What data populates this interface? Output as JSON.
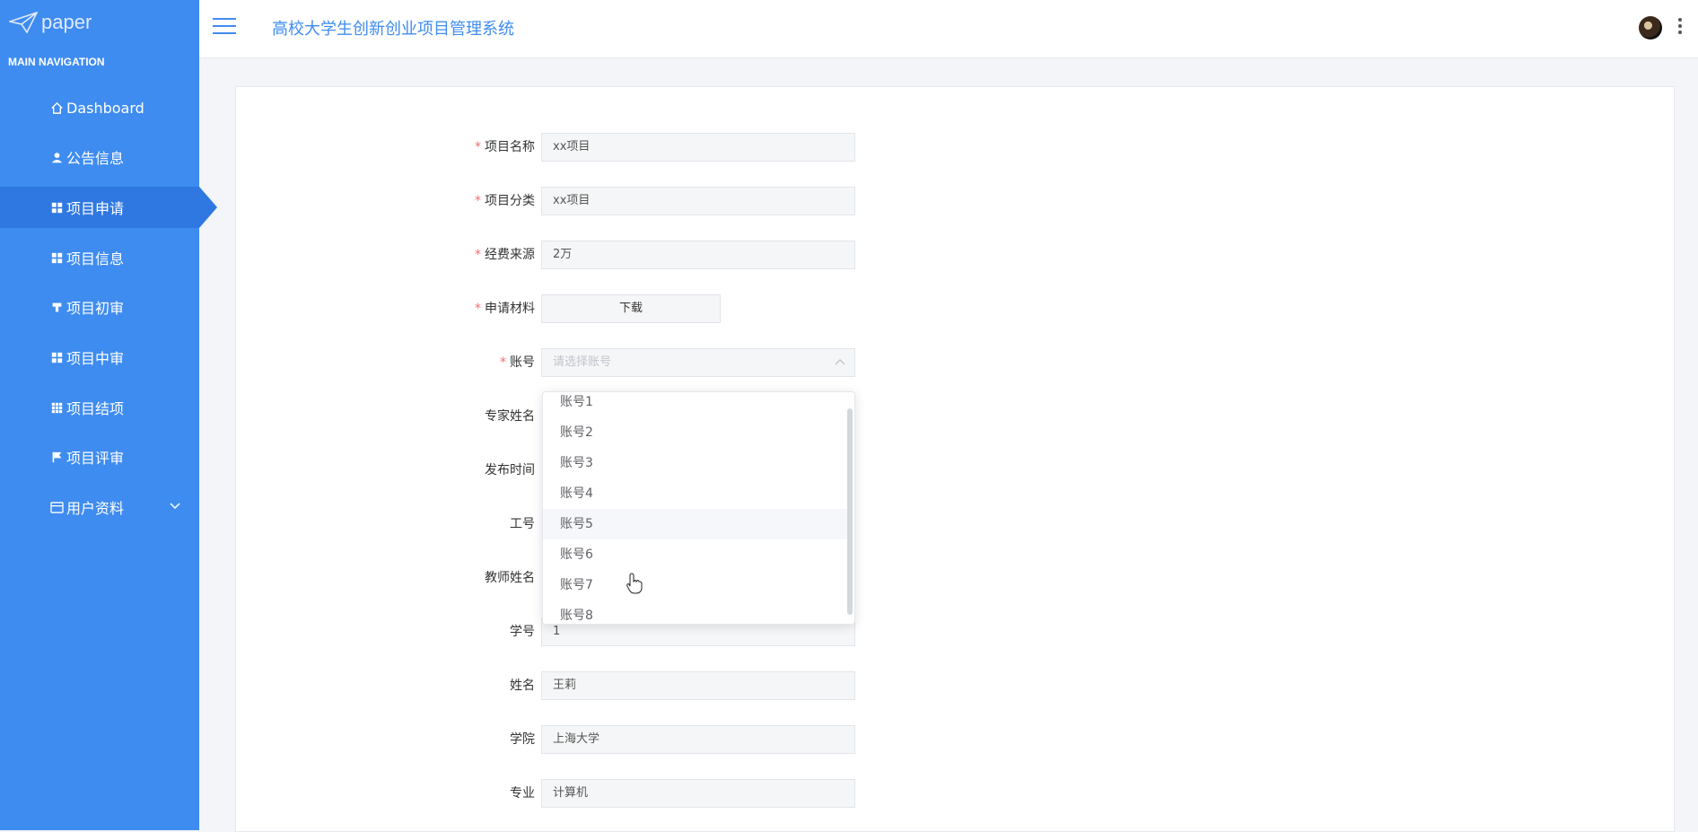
{
  "sidebar": {
    "logo_text": "paper",
    "header": "MAIN NAVIGATION",
    "items": [
      {
        "label": "Dashboard",
        "icon": "home-icon"
      },
      {
        "label": "公告信息",
        "icon": "user-icon"
      },
      {
        "label": "项目申请",
        "icon": "grid-icon",
        "active": true
      },
      {
        "label": "项目信息",
        "icon": "grid-icon"
      },
      {
        "label": "项目初审",
        "icon": "stamp-icon"
      },
      {
        "label": "项目中审",
        "icon": "grid-icon"
      },
      {
        "label": "项目结项",
        "icon": "table-icon"
      },
      {
        "label": "项目评审",
        "icon": "flag-icon"
      },
      {
        "label": "用户资料",
        "icon": "card-icon",
        "expandable": true
      }
    ]
  },
  "header": {
    "title": "高校大学生创新创业项目管理系统"
  },
  "form": {
    "project_name": {
      "label": "项目名称",
      "value": "xx项目",
      "required": true
    },
    "project_category": {
      "label": "项目分类",
      "value": "xx项目",
      "required": true
    },
    "funding_source": {
      "label": "经费来源",
      "value": "2万",
      "required": true
    },
    "materials": {
      "label": "申请材料",
      "button": "下载",
      "required": true
    },
    "account": {
      "label": "账号",
      "placeholder": "请选择账号",
      "required": true
    },
    "expert_name": {
      "label": "专家姓名"
    },
    "publish_time": {
      "label": "发布时间"
    },
    "employee_id": {
      "label": "工号"
    },
    "teacher_name": {
      "label": "教师姓名"
    },
    "student_id": {
      "label": "学号",
      "value": "1"
    },
    "name": {
      "label": "姓名",
      "value": "王莉"
    },
    "college": {
      "label": "学院",
      "value": "上海大学"
    },
    "major": {
      "label": "专业",
      "value": "计算机"
    }
  },
  "account_options": [
    "账号1",
    "账号2",
    "账号3",
    "账号4",
    "账号5",
    "账号6",
    "账号7",
    "账号8"
  ],
  "required_mark": "*"
}
